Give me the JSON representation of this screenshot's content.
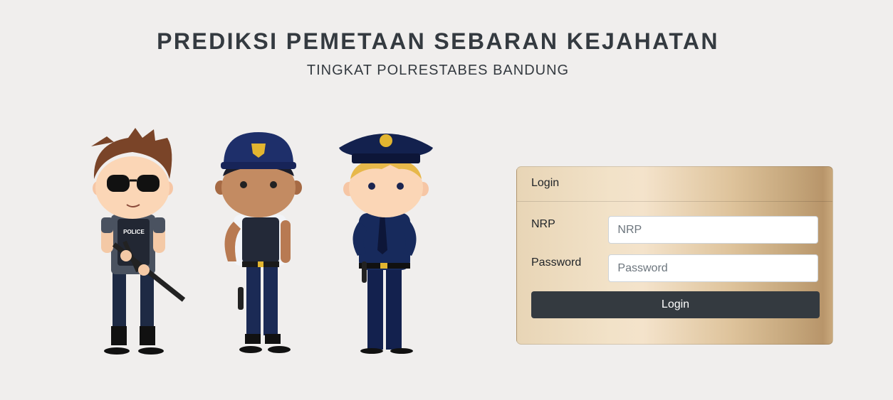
{
  "header": {
    "title": "PREDIKSI PEMETAAN SEBARAN KEJAHATAN",
    "subtitle": "TINGKAT POLRESTABES BANDUNG"
  },
  "illustration": {
    "badge_text": "POLICE",
    "figures": [
      "police-officer-with-rifle",
      "police-officer-with-vest",
      "police-officer-in-uniform"
    ]
  },
  "login": {
    "card_title": "Login",
    "nrp_label": "NRP",
    "nrp_placeholder": "NRP",
    "nrp_value": "",
    "password_label": "Password",
    "password_placeholder": "Password",
    "password_value": "",
    "submit_label": "Login"
  },
  "colors": {
    "background": "#f0eeed",
    "text_dark": "#343a40",
    "button": "#343a40",
    "card_gradient_light": "#f4e3cb",
    "card_gradient_dark": "#b8956a"
  }
}
